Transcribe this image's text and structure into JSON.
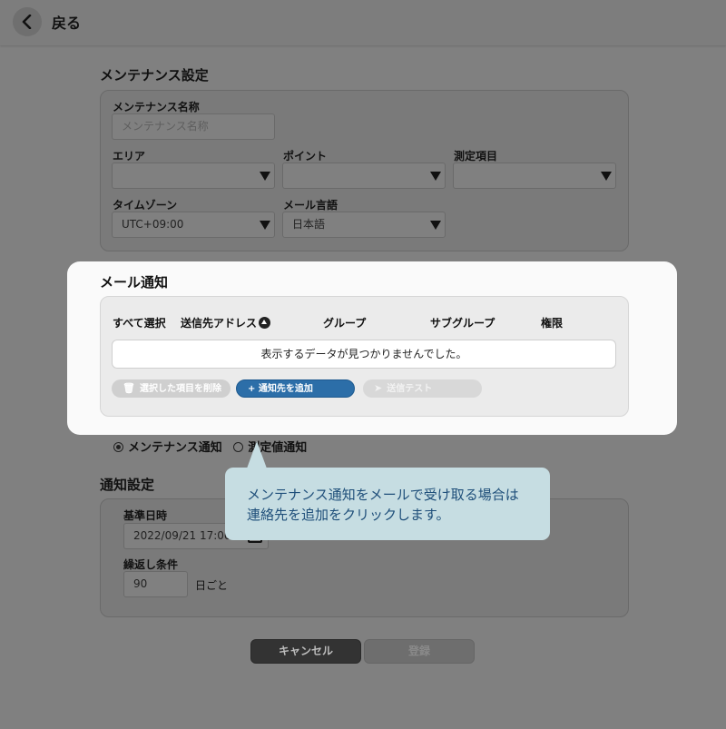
{
  "header": {
    "back_label": "戻る"
  },
  "maintenance": {
    "title": "メンテナンス設定",
    "name_label": "メンテナンス名称",
    "name_placeholder": "メンテナンス名称",
    "area_label": "エリア",
    "point_label": "ポイント",
    "measure_label": "測定項目",
    "timezone_label": "タイムゾーン",
    "timezone_value": "UTC+09:00",
    "language_label": "メール言語",
    "language_value": "日本語"
  },
  "mail": {
    "title": "メール通知",
    "columns": {
      "select_all": "すべて選択",
      "address": "送信先アドレス",
      "group": "グループ",
      "subgroup": "サブグループ",
      "permission": "権限"
    },
    "empty_message": "表示するデータが見つかりませんでした。",
    "delete_label": "選択した項目を削除",
    "add_label": "+ 通知先を追加",
    "test_label": "送信テスト"
  },
  "notify_type": {
    "option_maintenance": "メンテナンス通知",
    "option_measure": "測定値通知"
  },
  "notify_settings": {
    "title": "通知設定",
    "base_date_label": "基準日時",
    "base_date_value": "2022/09/21 17:00",
    "repeat_label": "繰返し条件",
    "repeat_value": "90",
    "repeat_unit": "日ごと"
  },
  "tooltip": {
    "line1": "メンテナンス通知をメールで受け取る場合は",
    "line2": "連絡先を追加をクリックします。"
  },
  "footer": {
    "cancel_label": "キャンセル",
    "submit_label": "登録"
  },
  "colors": {
    "accent": "#2c6ea8",
    "tooltip_bg": "#c6dde2",
    "tooltip_text": "#1f4f7a"
  }
}
